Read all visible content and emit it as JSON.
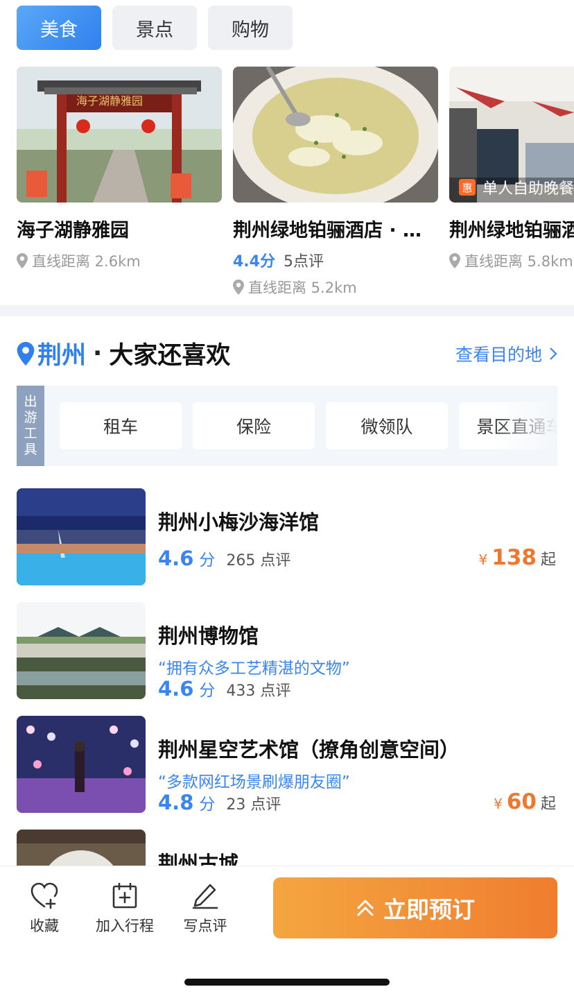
{
  "tabs": [
    "美食",
    "景点",
    "购物"
  ],
  "cards": [
    {
      "title": "海子湖静雅园",
      "distance": "直线距离 2.6km",
      "image_sign": "海子湖静雅园"
    },
    {
      "title": "荆州绿地铂骊酒店 · …",
      "score": "4.4分",
      "reviews": "5点评",
      "distance": "直线距离 5.2km"
    },
    {
      "title": "荆州绿地铂骊酒",
      "distance": "直线距离 5.8km",
      "deal_badge": "惠",
      "deal_text": "单人自助晚餐"
    }
  ],
  "section": {
    "city": "荆州",
    "dot": "·",
    "subtitle": "大家还喜欢",
    "more": "查看目的地"
  },
  "tools": {
    "label": [
      "出",
      "游",
      "工",
      "具"
    ],
    "items": [
      "租车",
      "保险",
      "微领队",
      "景区直通车"
    ]
  },
  "list": [
    {
      "name": "荆州小梅沙海洋馆",
      "score": "4.6",
      "unit": "分",
      "reviews": "265 点评",
      "currency": "¥",
      "price": "138",
      "price_suffix": "起"
    },
    {
      "name": "荆州博物馆",
      "quote": "“拥有众多工艺精湛的文物”",
      "score": "4.6",
      "unit": "分",
      "reviews": "433 点评"
    },
    {
      "name": "荆州星空艺术馆（撩角创意空间）",
      "quote": "“多款网红场景刷爆朋友圈”",
      "score": "4.8",
      "unit": "分",
      "reviews": "23 点评",
      "currency": "¥",
      "price": "60",
      "price_suffix": "起"
    },
    {
      "name": "荆州古城"
    }
  ],
  "bottom_bar": {
    "favorite": "收藏",
    "add_trip": "加入行程",
    "write_review": "写点评",
    "book": "立即预订"
  },
  "colors": {
    "accent": "#2f80ed",
    "price": "#f0772f",
    "book_button": "#f39a3a"
  }
}
